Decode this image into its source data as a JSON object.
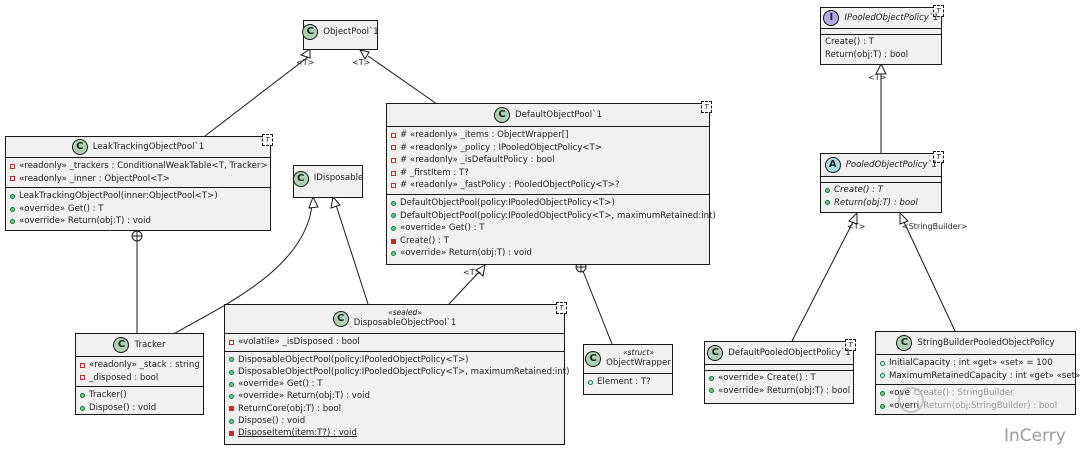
{
  "classes": {
    "objectpool": {
      "name": "ObjectPool`1"
    },
    "ipolicy": {
      "name": "IPooledObjectPolicy`1",
      "t": "T",
      "members": [
        "Create() : T",
        "Return(obj:T) : bool"
      ]
    },
    "leak": {
      "name": "LeakTrackingObjectPool`1",
      "t": "T",
      "fields": [
        "«readonly» _trackers : ConditionalWeakTable<T, Tracker>",
        "«readonly» _inner : ObjectPool<T>"
      ],
      "methods": [
        "LeakTrackingObjectPool(inner:ObjectPool<T>)",
        "«override» Get() : T",
        "«override» Return(obj:T) : void"
      ]
    },
    "idisposable": {
      "name": "IDisposable"
    },
    "default": {
      "name": "DefaultObjectPool`1",
      "t": "T",
      "fields": [
        "# «readonly» _items : ObjectWrapper[]",
        "# «readonly» _policy : IPooledObjectPolicy<T>",
        "# «readonly» _isDefaultPolicy : bool",
        "# _firstItem : T?",
        "# «readonly» _fastPolicy : PooledObjectPolicy<T>?"
      ],
      "methods": [
        "DefaultObjectPool(policy:IPooledObjectPolicy<T>)",
        "DefaultObjectPool(policy:IPooledObjectPolicy<T>, maximumRetained:int)",
        "«override» Get() : T",
        "Create() : T",
        "«override» Return(obj:T) : void"
      ]
    },
    "pooled": {
      "name": "PooledObjectPolicy`1",
      "t": "T",
      "members": [
        "Create() : T",
        "Return(obj:T) : bool"
      ]
    },
    "tracker": {
      "name": "Tracker",
      "fields": [
        "«readonly» _stack : string",
        "_disposed : bool"
      ],
      "methods": [
        "Tracker()",
        "Dispose() : void"
      ]
    },
    "disposable": {
      "stereotype": "«sealed»",
      "name": "DisposableObjectPool`1",
      "t": "T",
      "fields": [
        "«volatile» _isDisposed : bool"
      ],
      "methods": [
        "DisposableObjectPool(policy:IPooledObjectPolicy<T>)",
        "DisposableObjectPool(policy:IPooledObjectPolicy<T>, maximumRetained:int)",
        "«override» Get() : T",
        "«override» Return(obj:T) : void",
        "ReturnCore(obj:T) : bool",
        "Dispose() : void",
        "DisposeItem(item:T?) : void"
      ]
    },
    "wrapper": {
      "stereotype": "«struct»",
      "name": "ObjectWrapper",
      "fields": [
        "Element : T?"
      ]
    },
    "defpolicy": {
      "name": "DefaultPooledObjectPolicy`1",
      "t": "T",
      "methods": [
        "«override» Create() : T",
        "«override» Return(obj:T) : bool"
      ]
    },
    "sbpolicy": {
      "name": "StringBuilderPooledObjectPolicy",
      "fields": [
        "InitialCapacity : int «get» «set» = 100",
        "MaximumRetainedCapacity : int «get» «set»"
      ],
      "methods": [
        "«ove",
        "«overri"
      ]
    }
  },
  "edge_labels": {
    "t1": "<T>",
    "t2": "<T>",
    "t3": "<T>",
    "t4": "<T>",
    "t5": "<T>",
    "sb": "<StringBuilder>"
  },
  "watermark": {
    "text": "InCerry",
    "faded": "Create() : StringBuilder",
    "faded2": "Return(obj:StringBuilder) : bool"
  }
}
